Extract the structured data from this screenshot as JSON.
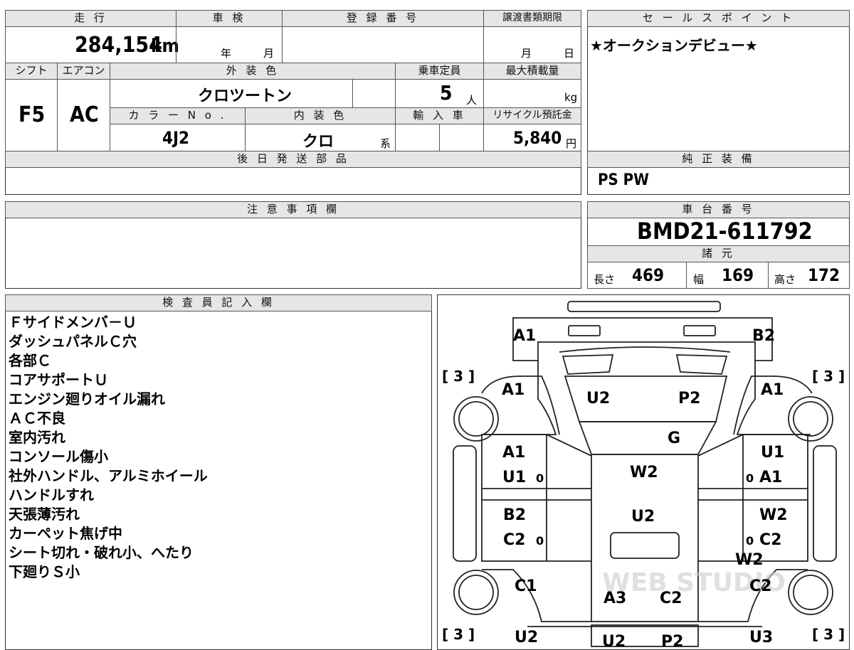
{
  "top": {
    "mileage_label": "走 行",
    "inspection_label": "車 検",
    "registration_label": "登 録 番 号",
    "transfer_deadline_label": "譲渡書類期限",
    "mileage_value": "284,154",
    "mileage_unit": "km",
    "year_unit": "年",
    "month_unit": "月",
    "deadline_month": "月",
    "deadline_day": "日"
  },
  "specs": {
    "shift_label": "シフト",
    "aircon_label": "エアコン",
    "exterior_color_label": "外 装 色",
    "capacity_label": "乗車定員",
    "max_load_label": "最大積載量",
    "shift_value": "F5",
    "aircon_value": "AC",
    "exterior_color_value": "クロツートン",
    "capacity_value": "5",
    "capacity_unit": "人",
    "max_load_unit": "kg",
    "color_no_label": "カ ラ ー N o .",
    "interior_color_label": "内 装 色",
    "import_label": "輸 入 車",
    "recycle_label": "リサイクル預託金",
    "color_no_value": "4J2",
    "interior_color_value": "クロ",
    "interior_suffix": "系",
    "recycle_value": "5,840",
    "recycle_unit": "円"
  },
  "later_parts": {
    "label": "後 日 発 送 部 品"
  },
  "sales_point": {
    "label": "セ ー ル ス ポ イ ン ト",
    "value": "★オークションデビュー★"
  },
  "standard_equipment": {
    "label": "純 正 装 備",
    "value": "PS PW"
  },
  "caution": {
    "label": "注 意 事 項 欄"
  },
  "chassis": {
    "label": "車 台 番 号",
    "value": "BMD21-611792"
  },
  "dimensions": {
    "label": "諸 元",
    "length_label": "長さ",
    "length_value": "469",
    "width_label": "幅",
    "width_value": "169",
    "height_label": "高さ",
    "height_value": "172"
  },
  "inspector": {
    "label": "検 査 員 記 入 欄",
    "lines": [
      "Ｆサイドメンバ－Ｕ",
      "ダッシュパネルＣ穴",
      "各部Ｃ",
      "コアサポートＵ",
      "エンジン廻りオイル漏れ",
      "ＡＣ不良",
      "室内汚れ",
      "コンソール傷小",
      "社外ハンドル、アルミホイール",
      "ハンドルすれ",
      "天張薄汚れ",
      "カーペット焦げ中",
      "シート切れ・破れ小、へたり",
      "下廻りＳ小"
    ]
  },
  "diagram": {
    "watermark": "WEB STUDIO",
    "tire_marks": [
      "[ 3 ]",
      "[ 3 ]",
      "[ 3 ]",
      "[ 3 ]"
    ],
    "zero": "0",
    "codes": {
      "front_left": "A1",
      "front_right": "B2",
      "fender_left": "A1",
      "fender_right": "A1",
      "hood_left": "U2",
      "hood_right": "P2",
      "windshield": "G",
      "front_door_left_1": "A1",
      "front_door_left_2": "U1",
      "front_door_right_1": "U1",
      "front_door_right_2": "A1",
      "roof_front": "W2",
      "rear_door_left_1": "B2",
      "rear_door_left_2": "C2",
      "rear_door_right_1": "W2",
      "rear_door_right_2": "C2",
      "roof_mid": "U2",
      "quarter_right_extra": "W2",
      "quarter_left": "C1",
      "quarter_right": "C2",
      "rear_center_1": "A3",
      "rear_center_2": "C2",
      "bottom_left": "U2",
      "bottom_center_1": "U2",
      "bottom_center_2": "P2",
      "bottom_right": "U3"
    }
  }
}
